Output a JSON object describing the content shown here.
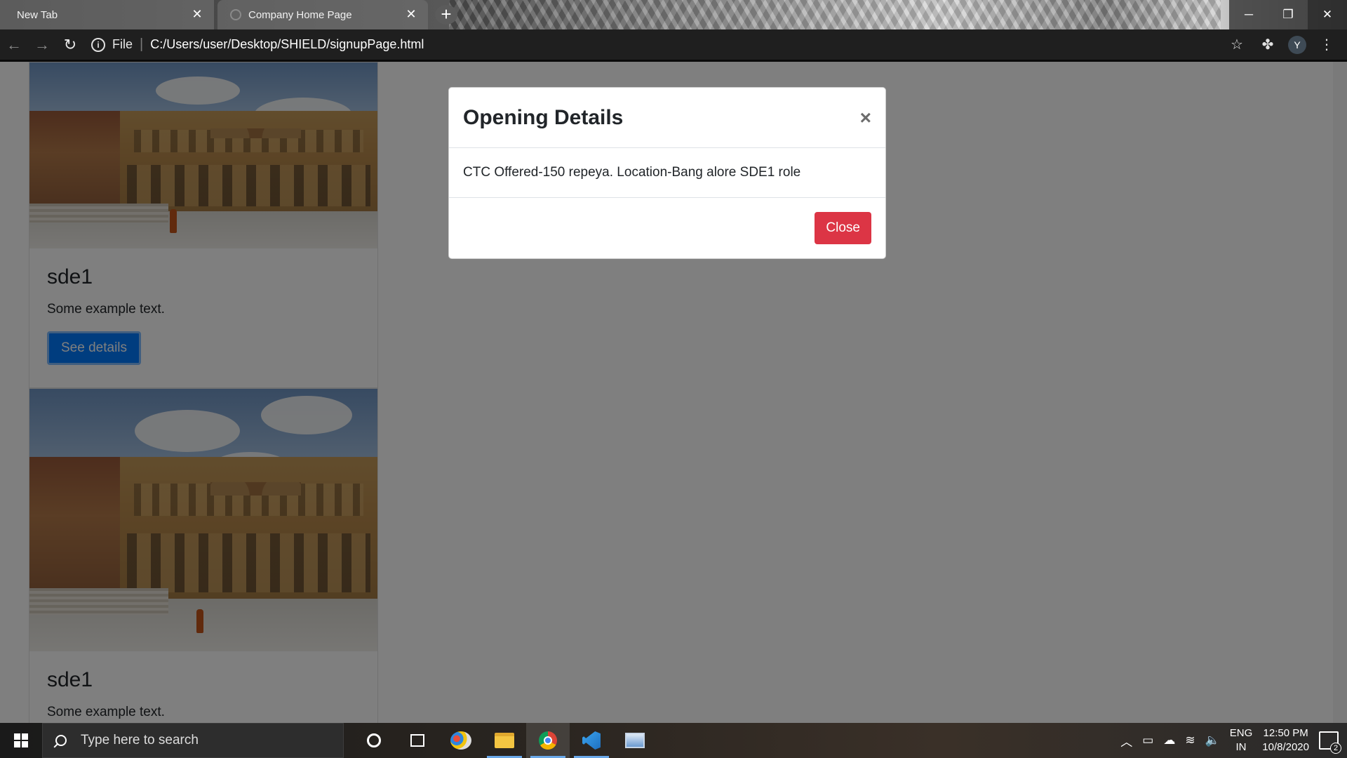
{
  "browser": {
    "tabs": [
      {
        "label": "New Tab",
        "active": false
      },
      {
        "label": "Company Home Page",
        "active": true
      }
    ],
    "new_tab_glyph": "+",
    "tab_close_glyph": "✕",
    "address": {
      "scheme_label": "File",
      "url": "C:/Users/user/Desktop/SHIELD/signupPage.html"
    },
    "profile_initial": "Y",
    "window_controls": {
      "minimize": "─",
      "maximize": "❐",
      "close": "✕"
    }
  },
  "page": {
    "cards": [
      {
        "title": "sde1",
        "text": "Some example text.",
        "button_label": "See details"
      },
      {
        "title": "sde1",
        "text": "Some example text."
      }
    ],
    "modal": {
      "title": "Opening Details",
      "close_glyph": "×",
      "body": "CTC Offered-150 repeya. Location-Bang alore SDE1 role",
      "close_button_label": "Close"
    }
  },
  "taskbar": {
    "search_placeholder": "Type here to search",
    "apps": [
      "cortana-icon",
      "task-view-icon",
      "paint-icon",
      "file-explorer-icon",
      "chrome-icon",
      "vscode-icon",
      "remote-desktop-icon"
    ],
    "tray": {
      "lang_top": "ENG",
      "lang_bottom": "IN",
      "time": "12:50 PM",
      "date": "10/8/2020",
      "notification_count": "2"
    }
  },
  "colors": {
    "primary": "#007bff",
    "danger": "#dc3545",
    "backdrop": "rgba(0,0,0,0.5)"
  }
}
